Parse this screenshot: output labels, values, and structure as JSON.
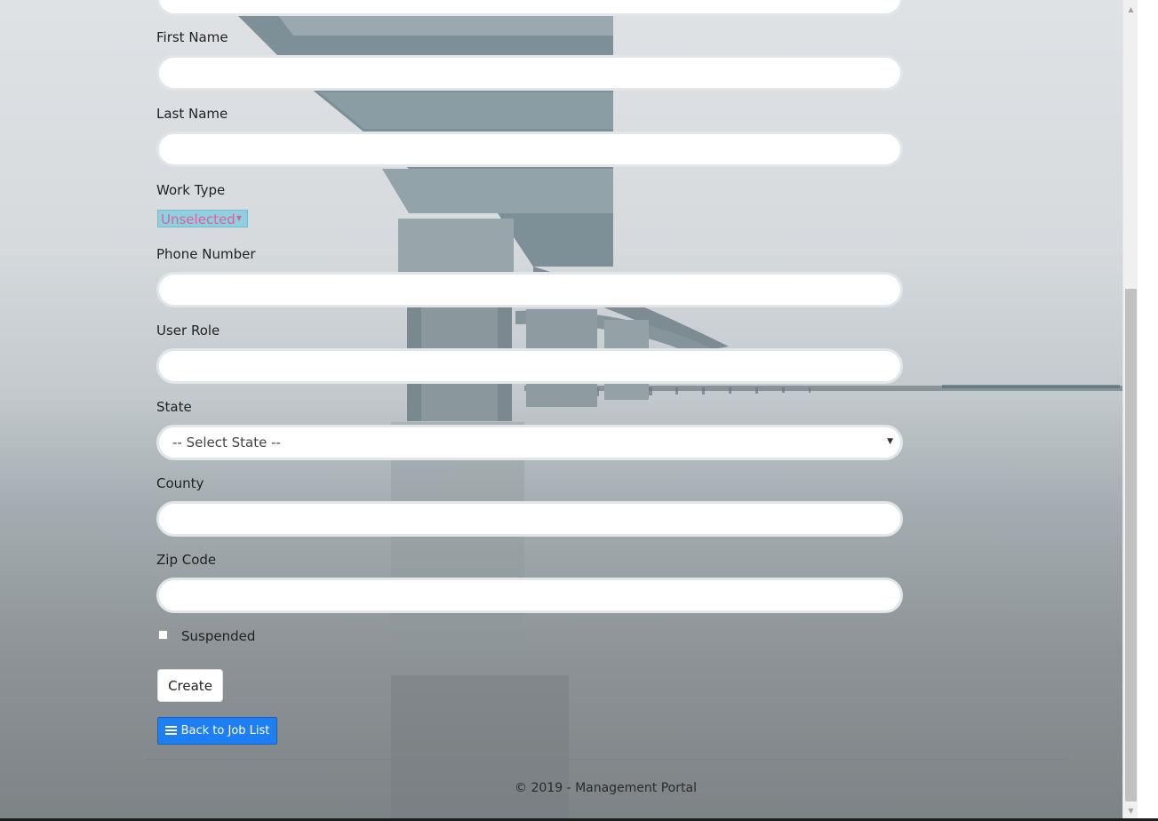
{
  "form": {
    "first_name_label": "First Name",
    "first_name_value": "",
    "last_name_label": "Last Name",
    "last_name_value": "",
    "work_type_label": "Work Type",
    "work_type_selected": "Unselected",
    "phone_label": "Phone Number",
    "phone_value": "",
    "user_role_label": "User Role",
    "user_role_value": "",
    "state_label": "State",
    "state_selected": "-- Select State --",
    "county_label": "County",
    "county_value": "",
    "zip_label": "Zip Code",
    "zip_value": "",
    "suspended_label": "Suspended",
    "suspended_checked": false,
    "create_label": "Create",
    "back_label": "Back to Job List"
  },
  "footer": {
    "text": "© 2019 - Management Portal"
  },
  "colors": {
    "primary_button": "#1e7ef3",
    "work_type_bg": "#8ecfe0",
    "work_type_text": "#e0609a"
  }
}
